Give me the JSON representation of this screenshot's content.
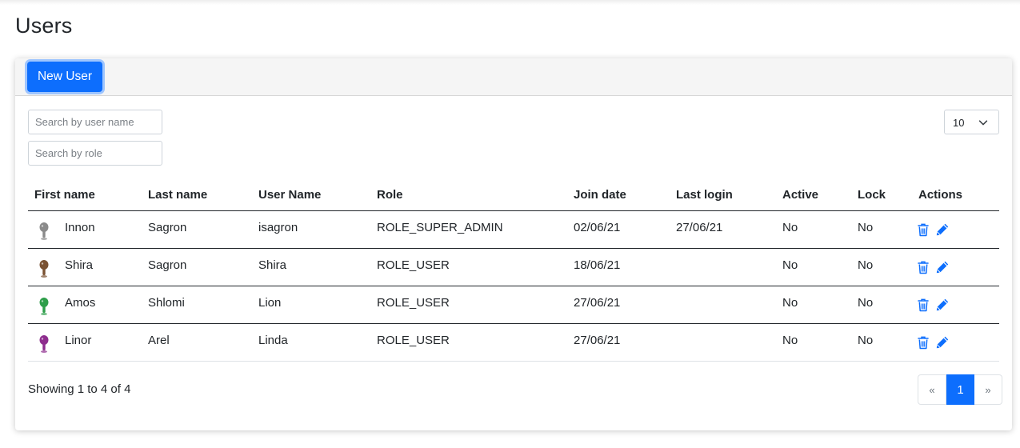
{
  "page": {
    "title": "Users"
  },
  "toolbar": {
    "new_user_label": "New User"
  },
  "filters": {
    "user_placeholder": "Search by user name",
    "role_placeholder": "Search by role",
    "page_size": "10"
  },
  "table": {
    "headers": [
      "First name",
      "Last name",
      "User Name",
      "Role",
      "Join date",
      "Last login",
      "Active",
      "Lock",
      "Actions"
    ],
    "rows": [
      {
        "avatar": "gray-figure",
        "first": "Innon",
        "last": "Sagron",
        "user": "isagron",
        "role": "ROLE_SUPER_ADMIN",
        "join": "02/06/21",
        "login": "27/06/21",
        "active": "No",
        "lock": "No"
      },
      {
        "avatar": "brown-figure",
        "first": "Shira",
        "last": "Sagron",
        "user": "Shira",
        "role": "ROLE_USER",
        "join": "18/06/21",
        "login": "",
        "active": "No",
        "lock": "No"
      },
      {
        "avatar": "green-figure",
        "first": "Amos",
        "last": "Shlomi",
        "user": "Lion",
        "role": "ROLE_USER",
        "join": "27/06/21",
        "login": "",
        "active": "No",
        "lock": "No"
      },
      {
        "avatar": "purple-figure",
        "first": "Linor",
        "last": "Arel",
        "user": "Linda",
        "role": "ROLE_USER",
        "join": "27/06/21",
        "login": "",
        "active": "No",
        "lock": "No"
      }
    ]
  },
  "footer": {
    "showing": "Showing 1 to 4 of 4",
    "prev": "«",
    "current": "1",
    "next": "»"
  },
  "colors": {
    "primary": "#0d6efd",
    "icon_blue": "#0d6efd",
    "avatars": {
      "gray-figure": "#8a8a8a",
      "brown-figure": "#7a5233",
      "green-figure": "#2e9e4a",
      "purple-figure": "#8e2d8e"
    }
  }
}
